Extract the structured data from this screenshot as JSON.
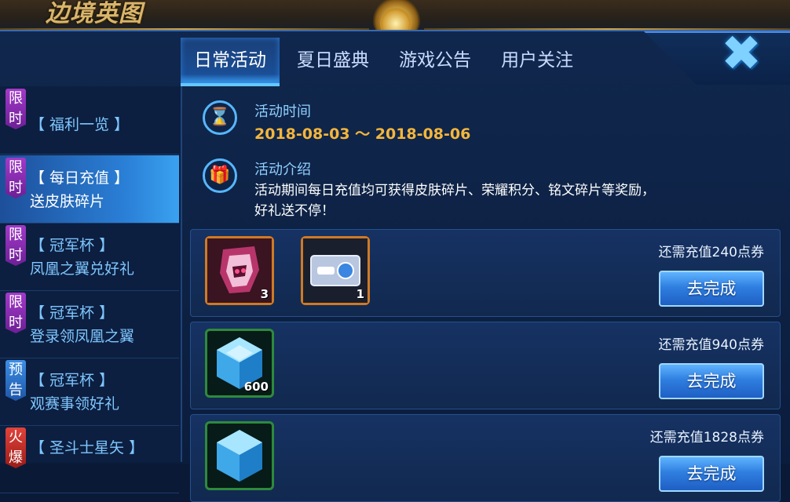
{
  "banner": {
    "title": "边境英图"
  },
  "tabs": [
    {
      "label": "日常活动",
      "active": true
    },
    {
      "label": "夏日盛典",
      "active": false
    },
    {
      "label": "游戏公告",
      "active": false
    },
    {
      "label": "用户关注",
      "active": false
    }
  ],
  "close_icon": "close-x-icon",
  "sidebar": {
    "items": [
      {
        "badge": "限时",
        "badge_color": "#8a2ab8",
        "line1": "【 福利一览 】",
        "line2": ""
      },
      {
        "badge": "限时",
        "badge_color": "#8a2ab8",
        "line1": "【 每日充值 】",
        "line2": "送皮肤碎片",
        "active": true
      },
      {
        "badge": "限时",
        "badge_color": "#8a2ab8",
        "line1": "【 冠军杯 】",
        "line2": "凤凰之翼兑好礼"
      },
      {
        "badge": "限时",
        "badge_color": "#8a2ab8",
        "line1": "【 冠军杯 】",
        "line2": "登录领凤凰之翼"
      },
      {
        "badge": "预告",
        "badge_color": "#2f7fe0",
        "line1": "【 冠军杯 】",
        "line2": "观赛事领好礼"
      },
      {
        "badge": "火爆",
        "badge_color": "#c8261f",
        "line1": "【 圣斗士星矢 】",
        "line2": ""
      }
    ]
  },
  "activity": {
    "time_label": "活动时间",
    "time_value": "2018-08-03 ～ 2018-08-06",
    "intro_label": "活动介绍",
    "intro_line1": "活动期间每日充值均可获得皮肤碎片、荣耀积分、铭文碎片等奖励，",
    "intro_line2": "好礼送不停！"
  },
  "tasks": [
    {
      "need": "还需充值240点券",
      "button": "去完成",
      "rewards": [
        {
          "icon": "skin-fragment-icon",
          "count": "3"
        },
        {
          "icon": "ticket-icon",
          "count": "1"
        }
      ]
    },
    {
      "need": "还需充值940点券",
      "button": "去完成",
      "rewards": [
        {
          "icon": "crystal-icon",
          "count": "600"
        }
      ]
    },
    {
      "need": "还需充值1828点券",
      "button": "去完成",
      "rewards": [
        {
          "icon": "crystal-icon",
          "count": ""
        }
      ]
    }
  ],
  "colors": {
    "accent_blue": "#3aa2f0",
    "gold": "#f5b63b",
    "badge_purple": "#8a2ab8",
    "badge_blue": "#2f7fe0",
    "badge_red": "#c8261f"
  }
}
